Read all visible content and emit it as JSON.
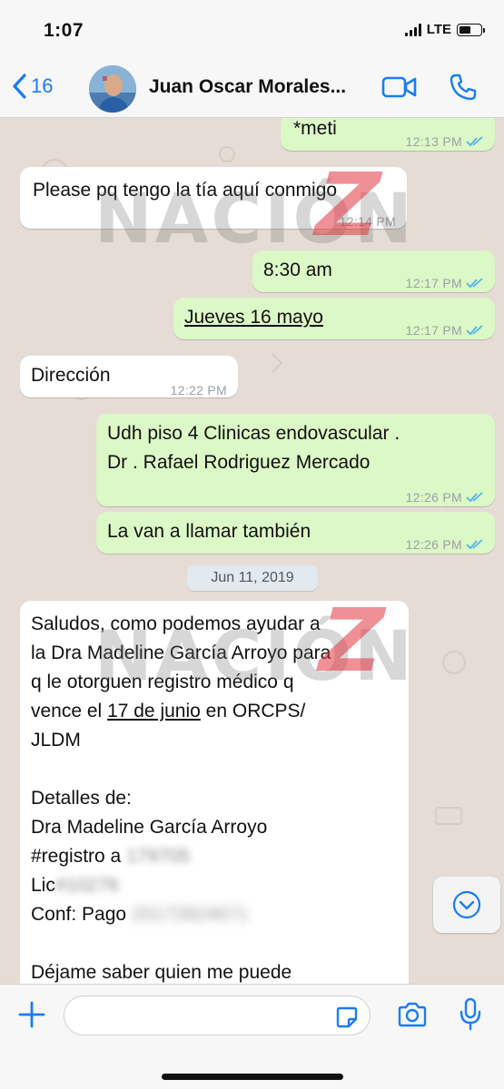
{
  "status_bar": {
    "time": "1:07",
    "network": "LTE"
  },
  "header": {
    "back_count": "16",
    "contact_name": "Juan Oscar Morales..."
  },
  "watermark": {
    "text": "NACIÓN",
    "accent": "Z"
  },
  "messages": [
    {
      "text": "*meti",
      "time": "12:13 PM",
      "outgoing": true
    },
    {
      "text": "Please pq tengo la tía aquí conmigo",
      "time": "12:14 PM",
      "outgoing": false
    },
    {
      "text": "8:30 am",
      "time": "12:17 PM",
      "outgoing": true
    },
    {
      "text": "Jueves 16 mayo",
      "time": "12:17 PM",
      "outgoing": true
    },
    {
      "text": "Dirección",
      "time": "12:22 PM",
      "outgoing": false
    },
    {
      "line1": "Udh piso 4 Clinicas endovascular .",
      "line2": "Dr . Rafael Rodriguez Mercado",
      "time": "12:26 PM",
      "outgoing": true
    },
    {
      "text": "La van a llamar también",
      "time": "12:26 PM",
      "outgoing": true
    }
  ],
  "date_separator": "Jun 11, 2019",
  "long_message": {
    "line1": "Saludos, como podemos ayudar a",
    "line2": "la Dra Madeline García Arroyo para",
    "line3": "q le otorguen registro médico q",
    "line4_prefix": "vence el ",
    "line4_link": "17 de junio",
    "line4_suffix": " en ORCPS/",
    "line5": "JLDM",
    "line6": "Detalles de:",
    "line7": "Dra Madeline García Arroyo",
    "line8_label": "#registro a ",
    "line8_blurred": "179705",
    "line9_label": "Lic",
    "line9_blurred": "#10276",
    "line10_label": "Conf: Pago ",
    "line10_blurred": "20172824671",
    "line11": "Déjame saber quien me puede"
  },
  "input": {
    "placeholder": "",
    "value": ""
  },
  "colors": {
    "accent": "#1a7cf5",
    "outgoing_bubble": "#dcf8c6",
    "incoming_bubble": "#ffffff",
    "chat_background": "#e5ddd5",
    "read_ticks": "#4fb5ec",
    "watermark_z": "#e2343f"
  }
}
